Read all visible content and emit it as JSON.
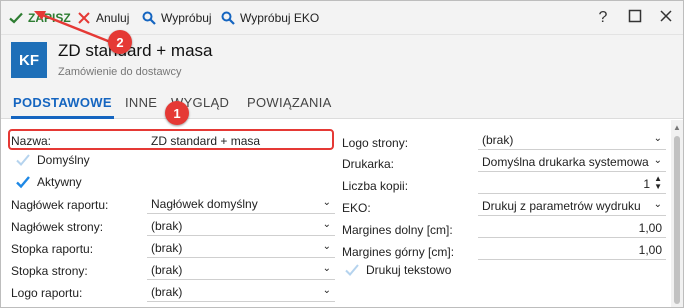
{
  "toolbar": {
    "save_label": "ZAPISZ",
    "cancel_label": "Anuluj",
    "try_label": "Wypróbuj",
    "try_eko_label": "Wypróbuj EKO",
    "help_glyph": "?",
    "maximize_glyph": "□",
    "close_glyph": "✕"
  },
  "header": {
    "avatar": "KF",
    "title": "ZD standard + masa",
    "subtitle": "Zamówienie do dostawcy"
  },
  "tabs": [
    {
      "label": "PODSTAWOWE",
      "active": true
    },
    {
      "label": "INNE",
      "active": false
    },
    {
      "label": "WYGLĄD",
      "active": false
    },
    {
      "label": "POWIĄZANIA",
      "active": false
    }
  ],
  "left": {
    "name_label": "Nazwa:",
    "name_value": "ZD standard + masa",
    "default_label": "Domyślny",
    "default_checked": false,
    "active_label": "Aktywny",
    "active_checked": true,
    "rows": [
      {
        "label": "Nagłówek raportu:",
        "value": "Nagłówek domyślny"
      },
      {
        "label": "Nagłówek strony:",
        "value": "(brak)"
      },
      {
        "label": "Stopka raportu:",
        "value": "(brak)"
      },
      {
        "label": "Stopka strony:",
        "value": "(brak)"
      },
      {
        "label": "Logo raportu:",
        "value": "(brak)"
      }
    ]
  },
  "right": {
    "logo_label": "Logo strony:",
    "logo_value": "(brak)",
    "printer_label": "Drukarka:",
    "printer_value": "Domyślna drukarka systemowa",
    "copies_label": "Liczba kopii:",
    "copies_value": "1",
    "eko_label": "EKO:",
    "eko_value": "Drukuj z parametrów wydruku",
    "margin_bottom_label": "Margines dolny [cm]:",
    "margin_bottom_value": "1,00",
    "margin_top_label": "Margines górny [cm]:",
    "margin_top_value": "1,00",
    "text_print_label": "Drukuj tekstowo",
    "text_print_checked": false
  },
  "annotations": {
    "badge_1": "1",
    "badge_2": "2",
    "color": "#e53935"
  },
  "colors": {
    "accent": "#1565c0",
    "save": "#2e7d32",
    "avatar_bg": "#1e6fb8"
  }
}
